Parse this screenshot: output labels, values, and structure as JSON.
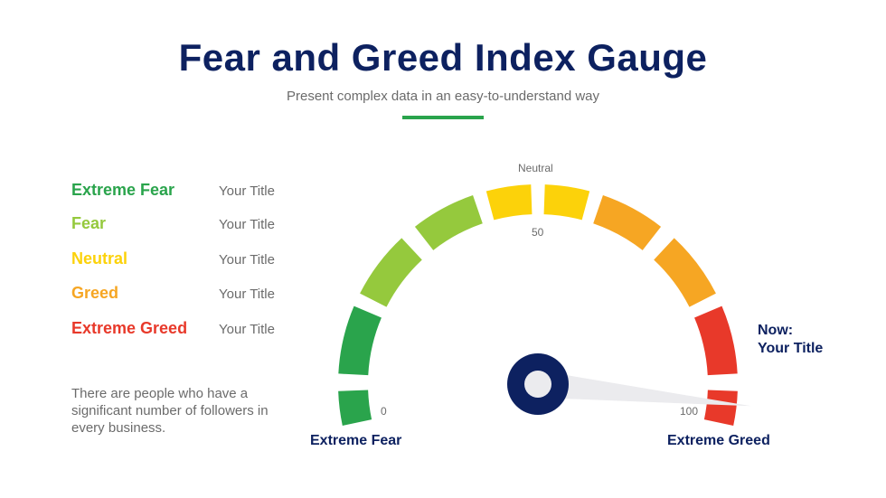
{
  "header": {
    "title": "Fear and Greed Index Gauge",
    "subtitle": "Present complex data in an easy-to-understand way",
    "accent_color": "#2aa44c"
  },
  "legend": [
    {
      "label": "Extreme Fear",
      "value": "Your Title",
      "color": "#2aa44c"
    },
    {
      "label": "Fear",
      "value": "Your Title",
      "color": "#95c93d"
    },
    {
      "label": "Neutral",
      "value": "Your Title",
      "color": "#fcd20a"
    },
    {
      "label": "Greed",
      "value": "Your Title",
      "color": "#f6a623"
    },
    {
      "label": "Extreme Greed",
      "value": "Your Title",
      "color": "#e8392a"
    }
  ],
  "description": "There are people who have a significant number of followers in every business.",
  "gauge": {
    "top_label": "Neutral",
    "min_label": "0",
    "mid_label": "50",
    "max_label": "100",
    "left_end_label": "Extreme Fear",
    "right_end_label": "Extreme Greed",
    "now_line1": "Now:",
    "now_line2": "Your Title",
    "min": 0,
    "max": 100,
    "needle_value": 97,
    "hub_color": "#0d2160",
    "needle_color": "#ebebee",
    "segments": [
      {
        "zone": "Extreme Fear",
        "color": "#2aa44c"
      },
      {
        "zone": "Extreme Fear",
        "color": "#2aa44c"
      },
      {
        "zone": "Fear",
        "color": "#95c93d"
      },
      {
        "zone": "Fear",
        "color": "#95c93d"
      },
      {
        "zone": "Neutral",
        "color": "#fcd20a"
      },
      {
        "zone": "Neutral",
        "color": "#fcd20a"
      },
      {
        "zone": "Greed",
        "color": "#f6a623"
      },
      {
        "zone": "Greed",
        "color": "#f6a623"
      },
      {
        "zone": "Extreme Greed",
        "color": "#e8392a"
      },
      {
        "zone": "Extreme Greed",
        "color": "#e8392a"
      }
    ]
  }
}
